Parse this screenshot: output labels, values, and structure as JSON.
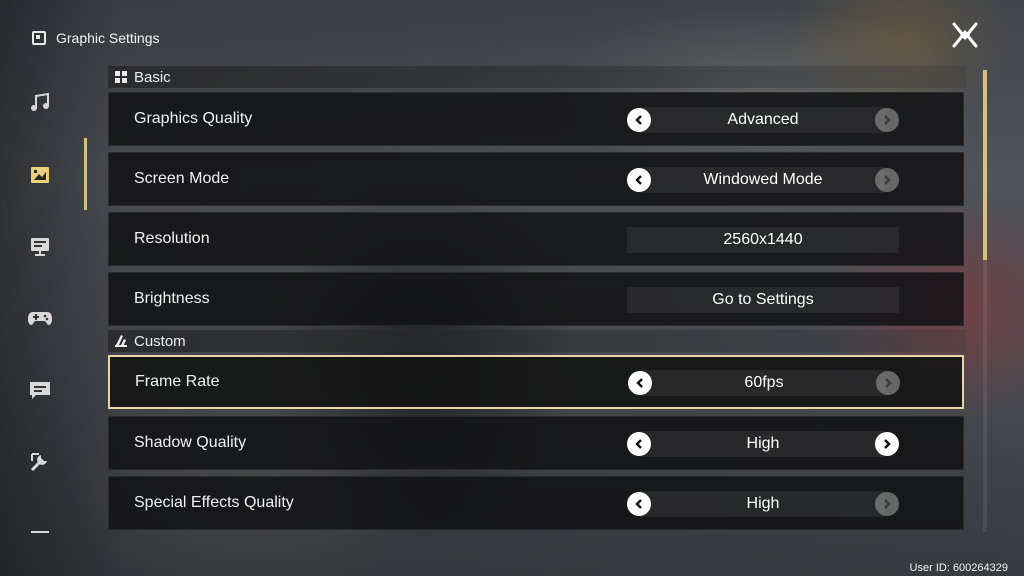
{
  "header": {
    "title": "Graphic Settings"
  },
  "sidebar": {
    "items": [
      {
        "icon": "music-note-icon",
        "active": false
      },
      {
        "icon": "graphics-icon",
        "active": true
      },
      {
        "icon": "display-icon",
        "active": false
      },
      {
        "icon": "gamepad-icon",
        "active": false
      },
      {
        "icon": "chat-icon",
        "active": false
      },
      {
        "icon": "tools-icon",
        "active": false
      },
      {
        "icon": "more-icon",
        "active": false
      }
    ]
  },
  "sections": {
    "basic": {
      "title": "Basic",
      "icon": "grid-icon"
    },
    "custom": {
      "title": "Custom",
      "icon": "sliders-icon"
    }
  },
  "settings": [
    {
      "label": "Graphics Quality",
      "value": "Advanced",
      "type": "selector",
      "right_enabled": false
    },
    {
      "label": "Screen Mode",
      "value": "Windowed Mode",
      "type": "selector",
      "right_enabled": false
    },
    {
      "label": "Resolution",
      "value": "2560x1440",
      "type": "button"
    },
    {
      "label": "Brightness",
      "value": "Go to Settings",
      "type": "button"
    },
    {
      "label": "Frame Rate",
      "value": "60fps",
      "type": "selector",
      "right_enabled": false,
      "selected": true
    },
    {
      "label": "Shadow Quality",
      "value": "High",
      "type": "selector",
      "right_enabled": true
    },
    {
      "label": "Special Effects Quality",
      "value": "High",
      "type": "selector",
      "right_enabled": false
    }
  ],
  "footer": {
    "user_id": "User ID: 600264329"
  },
  "colors": {
    "accent": "#d6c07e",
    "selected_border": "#e6d7a3",
    "row_bg": "#121214"
  }
}
